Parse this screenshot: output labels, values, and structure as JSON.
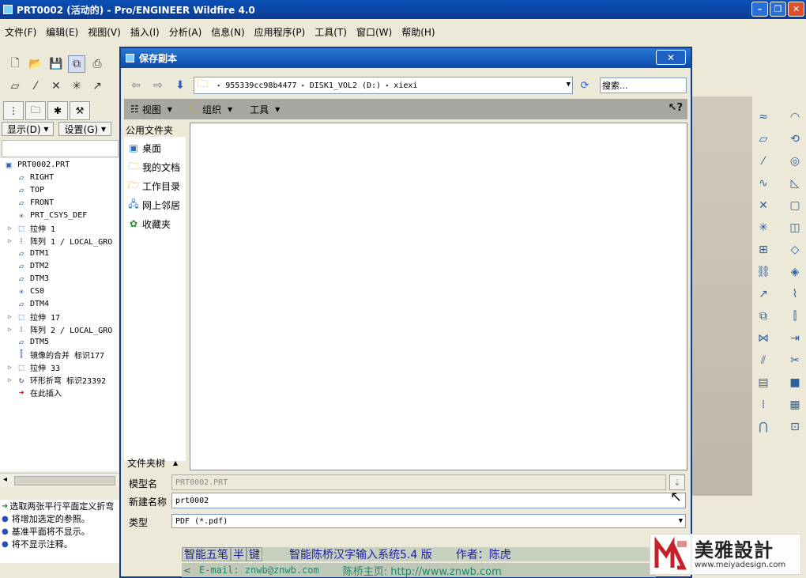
{
  "window": {
    "title": "PRT0002 (活动的) - Pro/ENGINEER Wildfire 4.0",
    "controls": [
      "–",
      "❐",
      "✕"
    ]
  },
  "menu": [
    "文件(F)",
    "编辑(E)",
    "视图(V)",
    "插入(I)",
    "分析(A)",
    "信息(N)",
    "应用程序(P)",
    "工具(T)",
    "窗口(W)",
    "帮助(H)"
  ],
  "model_tree": {
    "show_button": "显示(D)",
    "settings_button": "设置(G)",
    "items": [
      {
        "label": "PRT0002.PRT",
        "icon": "part-icon",
        "expandable": false,
        "indent": 0
      },
      {
        "label": "RIGHT",
        "icon": "datum-plane-icon",
        "expandable": false,
        "indent": 1
      },
      {
        "label": "TOP",
        "icon": "datum-plane-icon",
        "expandable": false,
        "indent": 1
      },
      {
        "label": "FRONT",
        "icon": "datum-plane-icon",
        "expandable": false,
        "indent": 1
      },
      {
        "label": "PRT_CSYS_DEF",
        "icon": "csys-icon",
        "expandable": false,
        "indent": 1
      },
      {
        "label": "拉伸 1",
        "icon": "extrude-icon",
        "expandable": true,
        "indent": 1
      },
      {
        "label": "阵列 1 / LOCAL_GRO",
        "icon": "pattern-icon",
        "expandable": true,
        "indent": 1
      },
      {
        "label": "DTM1",
        "icon": "datum-plane-icon",
        "expandable": false,
        "indent": 1
      },
      {
        "label": "DTM2",
        "icon": "datum-plane-icon",
        "expandable": false,
        "indent": 1
      },
      {
        "label": "DTM3",
        "icon": "datum-plane-icon",
        "expandable": false,
        "indent": 1
      },
      {
        "label": "CS0",
        "icon": "csys-icon",
        "expandable": false,
        "indent": 1
      },
      {
        "label": "DTM4",
        "icon": "datum-plane-icon",
        "expandable": false,
        "indent": 1
      },
      {
        "label": "拉伸 17",
        "icon": "extrude-icon",
        "expandable": true,
        "indent": 1
      },
      {
        "label": "阵列 2 / LOCAL_GRO",
        "icon": "pattern-icon",
        "expandable": true,
        "indent": 1
      },
      {
        "label": "DTM5",
        "icon": "datum-plane-icon",
        "expandable": false,
        "indent": 1
      },
      {
        "label": "镜像的合并 标识177",
        "icon": "mirror-icon",
        "expandable": false,
        "indent": 1
      },
      {
        "label": "拉伸 33",
        "icon": "extrude-icon",
        "expandable": true,
        "indent": 1
      },
      {
        "label": "环形折弯 标识23392",
        "icon": "toroidal-bend-icon",
        "expandable": true,
        "indent": 1
      },
      {
        "label": "在此插入",
        "icon": "insert-here-icon",
        "expandable": false,
        "indent": 1
      }
    ]
  },
  "messages": [
    {
      "text": "选取两张平行平面定义折弯",
      "icon": "arrow-right-icon"
    },
    {
      "text": "将增加选定的参照。",
      "icon": "bullet-icon"
    },
    {
      "text": "基准平面将不显示。",
      "icon": "bullet-icon"
    },
    {
      "text": "将不显示注释。",
      "icon": "bullet-icon"
    }
  ],
  "dialog": {
    "title": "保存副本",
    "close_label": "✕",
    "path_segments": [
      "955339cc98b4477",
      "DISK1_VOL2 (D:)",
      "xiexi"
    ],
    "search_placeholder": "搜索...",
    "commands": [
      {
        "label": "视图",
        "icon": "view-icon"
      },
      {
        "label": "组织",
        "icon": "organize-icon"
      },
      {
        "label": "工具",
        "icon": "tools-icon"
      }
    ],
    "common_folders_title": "公用文件夹",
    "common_folders": [
      {
        "label": "桌面",
        "icon": "desktop-icon"
      },
      {
        "label": "我的文档",
        "icon": "my-documents-icon"
      },
      {
        "label": "工作目录",
        "icon": "working-directory-icon"
      },
      {
        "label": "网上邻居",
        "icon": "network-icon"
      },
      {
        "label": "收藏夹",
        "icon": "favorites-icon"
      }
    ],
    "folder_tree_label": "文件夹树",
    "model_name_label": "模型名",
    "model_name_value": "PRT0002.PRT",
    "new_name_label": "新建名称",
    "new_name_value": "prt0002",
    "type_label": "类型",
    "type_value": "PDF (*.pdf)"
  },
  "ime": {
    "cells": [
      "智能五笔",
      "半",
      "键"
    ],
    "title": "智能陈桥汉字输入系统5.4 版",
    "author": "作者：陈虎",
    "email": "E-mail: znwb@znwb.com",
    "homepage": "陈桥主页: http://www.znwb.com"
  },
  "watermark": {
    "name": "美雅設計",
    "url": "www.meiyadesign.com"
  },
  "colors": {
    "title_bar": "#0b4aa8",
    "dialog_border": "#0a3d94",
    "ime_text": "#1a1aa8"
  }
}
